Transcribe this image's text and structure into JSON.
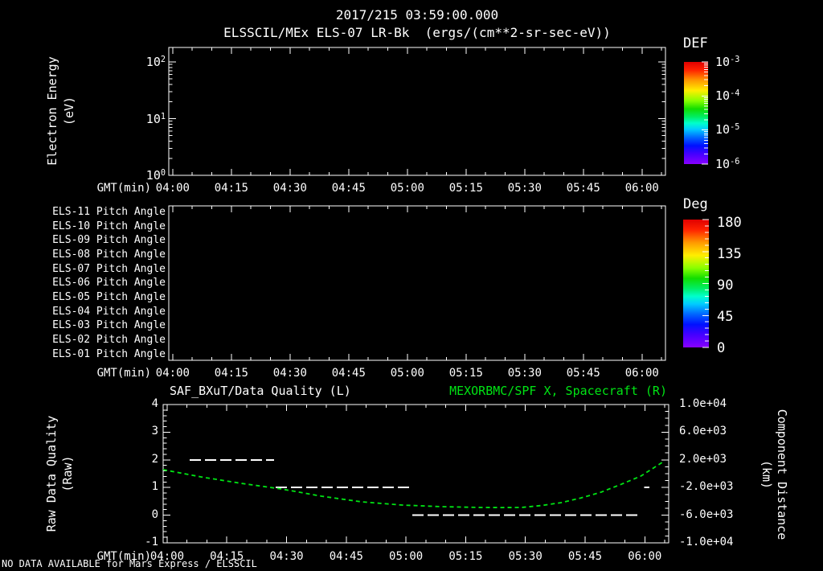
{
  "title": {
    "line1": "2017/215 03:59:00.000",
    "line2": "ELSSCIL/MEx ELS-07 LR-Bk  (ergs/(cm**2-sr-sec-eV))"
  },
  "note": "NO DATA AVAILABLE for Mars Express / ELSSCIL",
  "time_axis": {
    "label": "GMT(min)",
    "tick_labels": [
      "04:00",
      "04:15",
      "04:30",
      "04:45",
      "05:00",
      "05:15",
      "05:30",
      "05:45",
      "06:00"
    ],
    "first_tick_offset_min": 1,
    "major_step_min": 15,
    "minor_step_min": 5,
    "span_min": 127,
    "start_time": "03:59",
    "end_time": "06:06"
  },
  "panels": {
    "energy": {
      "ylabel1": "Electron Energy",
      "ylabel2": "(eV)",
      "ytick_labels": [
        {
          "base": "10",
          "exp": "2"
        },
        {
          "base": "10",
          "exp": "1"
        },
        {
          "base": "10",
          "exp": "0"
        }
      ],
      "colorbar_title": "DEF",
      "colorbar_ticks": [
        {
          "base": "10",
          "exp": "-3"
        },
        {
          "base": "10",
          "exp": "-4"
        },
        {
          "base": "10",
          "exp": "-5"
        },
        {
          "base": "10",
          "exp": "-6"
        }
      ]
    },
    "pitch": {
      "rows": [
        "ELS-11 Pitch Angle",
        "ELS-10 Pitch Angle",
        "ELS-09 Pitch Angle",
        "ELS-08 Pitch Angle",
        "ELS-07 Pitch Angle",
        "ELS-06 Pitch Angle",
        "ELS-05 Pitch Angle",
        "ELS-04 Pitch Angle",
        "ELS-03 Pitch Angle",
        "ELS-02 Pitch Angle",
        "ELS-01 Pitch Angle"
      ],
      "colorbar_title": "Deg",
      "colorbar_ticks": [
        "180",
        "135",
        "90",
        "45",
        "0"
      ]
    },
    "quality": {
      "header_left": "SAF_BXuT/Data Quality (L)",
      "header_right": "MEXORBMC/SPF X, Spacecraft (R)",
      "ylabel_left1": "Raw Data Quality",
      "ylabel_left2": "(Raw)",
      "ylabel_right1": "Component Distance",
      "ylabel_right2": "(km)",
      "left_tick_labels": [
        "4",
        "3",
        "2",
        "1",
        "0",
        "-1"
      ],
      "right_tick_labels": [
        "1.0e+04",
        "6.0e+03",
        "2.0e+03",
        "-2.0e+03",
        "-6.0e+03",
        "-1.0e+04"
      ]
    }
  },
  "colors": {
    "background": "#000000",
    "foreground": "#ffffff",
    "accent_green": "#00e414"
  },
  "chart_data": [
    {
      "type": "heatmap",
      "panel": "energy-spectrogram",
      "title": "ELSSCIL/MEx ELS-07 LR-Bk",
      "units": "ergs/(cm**2-sr-sec-eV)",
      "xlabel": "GMT(min)",
      "x_tick_labels": [
        "04:00",
        "04:15",
        "04:30",
        "04:45",
        "05:00",
        "05:15",
        "05:30",
        "05:45",
        "06:00"
      ],
      "x_range": [
        "03:59",
        "06:06"
      ],
      "ylabel": "Electron Energy (eV)",
      "yscale": "log",
      "ylim": [
        1,
        200
      ],
      "colorbar": {
        "label": "DEF",
        "scale": "log",
        "tick_values": [
          0.001,
          0.0001,
          1e-05,
          1e-06
        ]
      },
      "values": [],
      "note": "no data plotted"
    },
    {
      "type": "heatmap",
      "panel": "pitch-angle",
      "xlabel": "GMT(min)",
      "rows": [
        "ELS-11 Pitch Angle",
        "ELS-10 Pitch Angle",
        "ELS-09 Pitch Angle",
        "ELS-08 Pitch Angle",
        "ELS-07 Pitch Angle",
        "ELS-06 Pitch Angle",
        "ELS-05 Pitch Angle",
        "ELS-04 Pitch Angle",
        "ELS-03 Pitch Angle",
        "ELS-02 Pitch Angle",
        "ELS-01 Pitch Angle"
      ],
      "colorbar": {
        "label": "Deg",
        "lim": [
          0,
          180
        ],
        "tick_values": [
          180,
          135,
          90,
          45,
          0
        ]
      },
      "values": [],
      "note": "no data plotted"
    },
    {
      "type": "line",
      "panel": "quality-distance",
      "xlabel": "GMT(min)",
      "x_unit": "minutes after 03:59",
      "x_span_min": 127,
      "left_axis": {
        "label": "Raw Data Quality (Raw)",
        "lim": [
          -1,
          4
        ],
        "ticks": [
          4,
          3,
          2,
          1,
          0,
          -1
        ]
      },
      "right_axis": {
        "label": "Component Distance (km)",
        "lim": [
          -10000,
          10000
        ],
        "ticks": [
          10000,
          6000,
          2000,
          -2000,
          -6000,
          -10000
        ]
      },
      "series": [
        {
          "name": "SAF_BXuT/Data Quality (L)",
          "axis": "left",
          "color": "#ffffff",
          "style": "dashed",
          "segments": [
            {
              "t_min": 6.7,
              "t_max": 27.9,
              "value": 2
            },
            {
              "t_min": 28.3,
              "t_max": 62.2,
              "value": 1
            },
            {
              "t_min": 62.6,
              "t_max": 120.1,
              "value": 0
            },
            {
              "t_min": 120.8,
              "t_max": 122.2,
              "value": 1
            }
          ]
        },
        {
          "name": "MEXORBMC/SPF X, Spacecraft (R)",
          "axis": "right",
          "color": "#00e414",
          "style": "dashed",
          "points": [
            [
              0,
              580
            ],
            [
              9.5,
              -465
            ],
            [
              19.6,
              -1395
            ],
            [
              29.7,
              -2210
            ],
            [
              39.8,
              -3255
            ],
            [
              49.9,
              -4070
            ],
            [
              60,
              -4535
            ],
            [
              70,
              -4770
            ],
            [
              80,
              -4885
            ],
            [
              85,
              -4900
            ],
            [
              90,
              -4885
            ],
            [
              95,
              -4600
            ],
            [
              100,
              -4185
            ],
            [
              105,
              -3500
            ],
            [
              110,
              -2675
            ],
            [
              115,
              -1550
            ],
            [
              120,
              -350
            ],
            [
              126,
              1860
            ]
          ]
        }
      ]
    }
  ]
}
